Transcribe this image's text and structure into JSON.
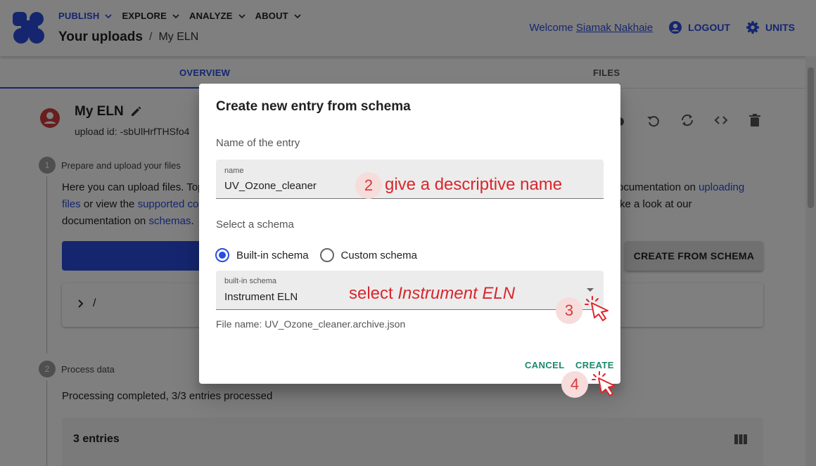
{
  "header": {
    "nav": [
      {
        "label": "PUBLISH"
      },
      {
        "label": "EXPLORE"
      },
      {
        "label": "ANALYZE"
      },
      {
        "label": "ABOUT"
      }
    ],
    "breadcrumb_title": "Your uploads",
    "breadcrumb_sep": "/",
    "breadcrumb_current": "My ELN",
    "welcome_prefix": "Welcome",
    "user_name": "Siamak Nakhaie",
    "logout_label": "LOGOUT",
    "units_label": "UNITS"
  },
  "tabs": {
    "overview": "OVERVIEW",
    "files": "FILES"
  },
  "upload": {
    "title": "My ELN",
    "id_text": "upload id: -sbUlHrfTHSfo4"
  },
  "step1": {
    "number": "1",
    "label": "Prepare and upload your files",
    "text_a": "Here you can upload files. Top",
    "text_a_right": "ocumentation on",
    "link_uploading": "uploading",
    "link_files": "files",
    "text_b": "or view the",
    "link_supported": "supported co",
    "text_b_right": "ke a look at our",
    "text_c": "documentation on",
    "link_schemas": "schemas",
    "text_c_end": ".",
    "create_from_schema": "CREATE FROM SCHEMA",
    "file_path": "/"
  },
  "step2": {
    "number": "2",
    "label": "Process data",
    "status": "Processing completed, 3/3 entries processed",
    "entries_title": "3 entries"
  },
  "dialog": {
    "title": "Create new entry from schema",
    "name_section": "Name of the entry",
    "name_field_label": "name",
    "name_field_value": "UV_Ozone_cleaner",
    "schema_section": "Select a schema",
    "radio_builtin": "Built-in schema",
    "radio_custom": "Custom schema",
    "builtin_field_label": "built-in schema",
    "builtin_field_value": "Instrument ELN",
    "file_name": "File name: UV_Ozone_cleaner.archive.json",
    "cancel_label": "CANCEL",
    "create_label": "CREATE"
  },
  "annotations": {
    "step2_number": "2",
    "step2_text": "give a descriptive name",
    "step3_number": "3",
    "step3_text_prefix": "select",
    "step3_text_italic": "Instrument ELN",
    "step4_number": "4"
  },
  "colors": {
    "primary": "#2a4cdf",
    "dialog_action": "#188a6b",
    "annotation": "#d9262b"
  }
}
